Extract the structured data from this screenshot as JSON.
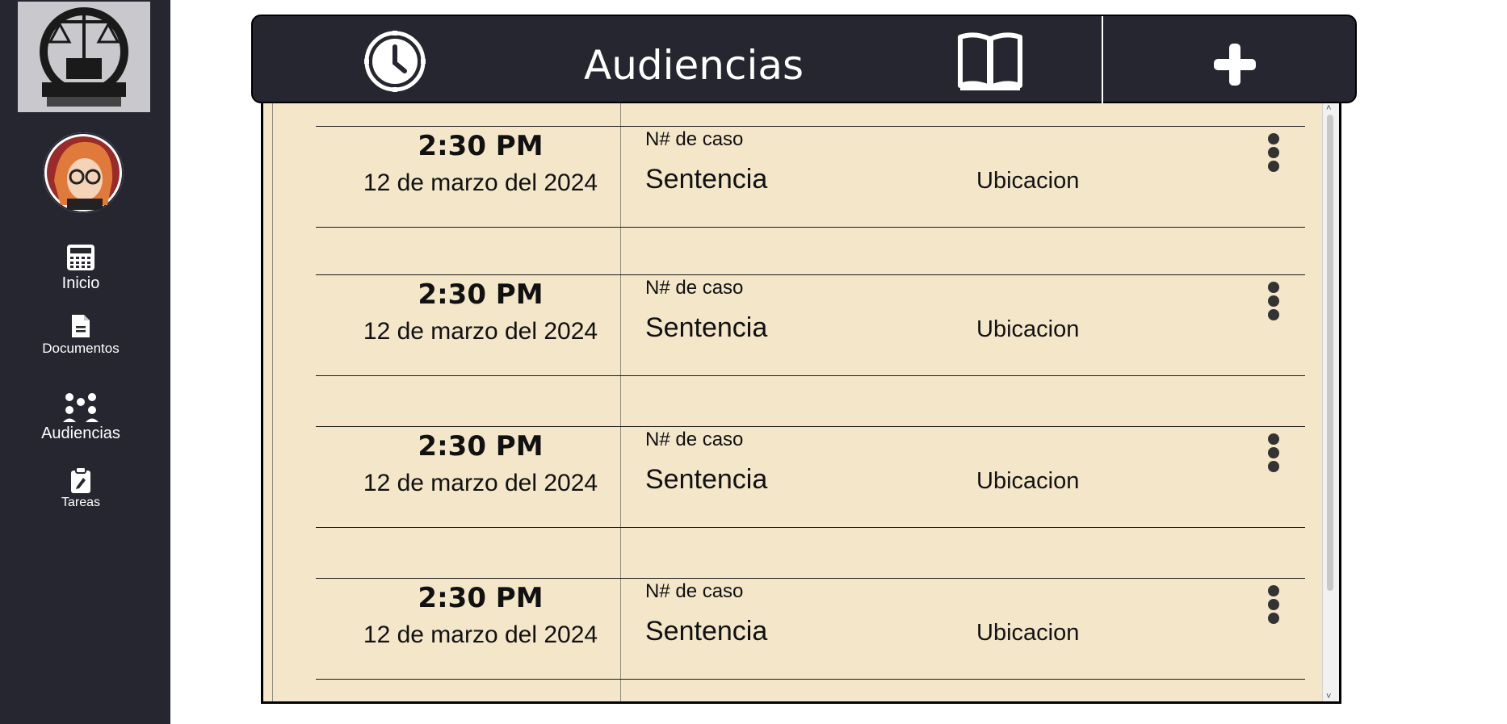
{
  "sidebar": {
    "items": [
      {
        "label": "Inicio",
        "icon": "calculator-icon"
      },
      {
        "label": "Documentos",
        "icon": "document-icon"
      },
      {
        "label": "Audiencias",
        "icon": "people-icon"
      },
      {
        "label": "Tareas",
        "icon": "clipboard-edit-icon"
      }
    ]
  },
  "header": {
    "title": "Audiencias",
    "clock_icon": "clock-icon",
    "book_icon": "book-icon",
    "add_icon": "plus-icon"
  },
  "hearings": [
    {
      "time": "2:30 PM",
      "date": "12 de marzo del 2024",
      "case": "N# de caso",
      "type": "Sentencia",
      "location": "Ubicacion"
    },
    {
      "time": "2:30 PM",
      "date": "12 de marzo del 2024",
      "case": "N# de caso",
      "type": "Sentencia",
      "location": "Ubicacion"
    },
    {
      "time": "2:30 PM",
      "date": "12 de marzo del 2024",
      "case": "N# de caso",
      "type": "Sentencia",
      "location": "Ubicacion"
    },
    {
      "time": "2:30 PM",
      "date": "12 de marzo del 2024",
      "case": "N# de caso",
      "type": "Sentencia",
      "location": "Ubicacion"
    }
  ],
  "colors": {
    "sidebar_bg": "#262630",
    "header_bg": "#262630",
    "panel_bg": "#f3e6c9"
  }
}
